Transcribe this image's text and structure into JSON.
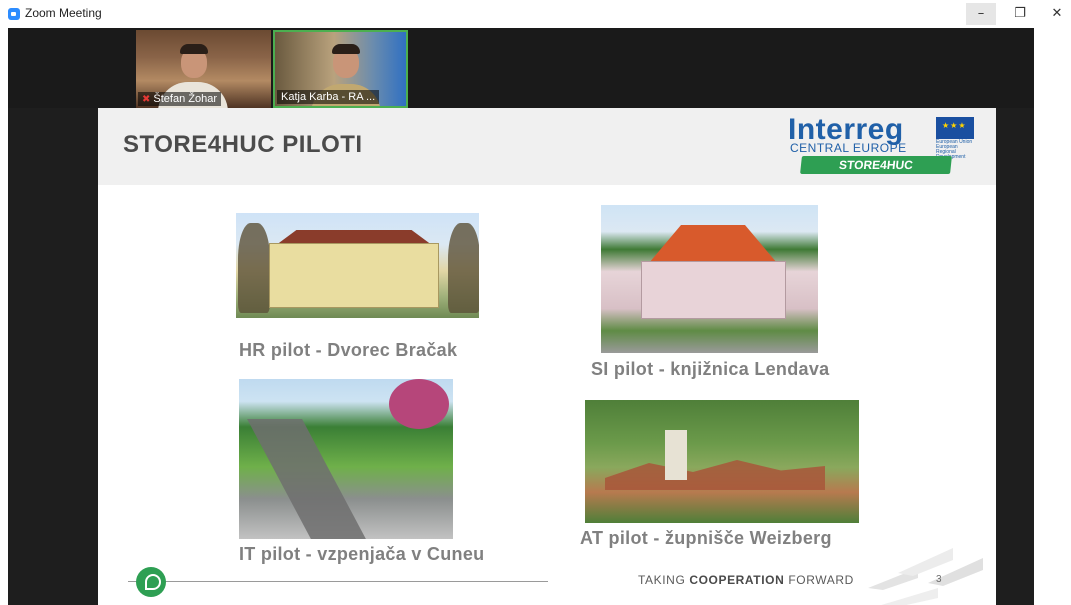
{
  "window": {
    "title": "Zoom Meeting",
    "minimize_glyph": "–",
    "restore_glyph": "❐",
    "close_glyph": "✕"
  },
  "participants": [
    {
      "name": "Štefan Žohar",
      "muted": true,
      "active_speaker": false
    },
    {
      "name": "Katja Karba - RA ...",
      "muted": false,
      "active_speaker": true
    }
  ],
  "slide": {
    "title": "STORE4HUC PILOTI",
    "logo": {
      "interreg": "Interreg",
      "central": "CENTRAL EUROPE",
      "project": "STORE4HUC",
      "eu_small_text": "European Union European Regional Development Fund"
    },
    "pilots": {
      "hr": "HR pilot - Dvorec Bračak",
      "si": "SI pilot - knjižnica Lendava",
      "it": "IT pilot - vzpenjača v Cuneu",
      "at": "AT pilot - župnišče Weizberg"
    },
    "tagline_prefix": "TAKING ",
    "tagline_bold": "COOPERATION",
    "tagline_suffix": " FORWARD",
    "page_number": "3"
  },
  "colors": {
    "interreg_blue": "#2060a8",
    "store_green": "#2e9f53",
    "caption_gray": "#808080",
    "active_speaker": "#4caf50"
  }
}
